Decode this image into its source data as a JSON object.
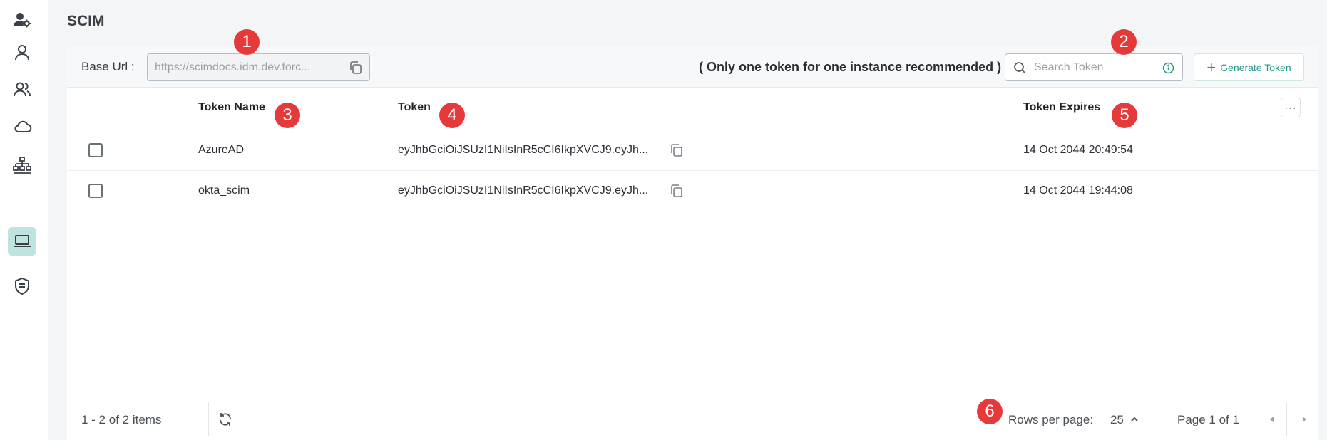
{
  "sidebar": {
    "items": [
      {
        "icon": "user-gear-icon",
        "active": false
      },
      {
        "icon": "user-icon",
        "active": false
      },
      {
        "icon": "users-icon",
        "active": false
      },
      {
        "icon": "cloud-icon",
        "active": false
      },
      {
        "icon": "hierarchy-icon",
        "active": false
      },
      {
        "icon": "laptop-icon",
        "active": true
      },
      {
        "icon": "shield-icon",
        "active": false
      }
    ]
  },
  "page": {
    "title": "SCIM"
  },
  "toolbar": {
    "base_url_label": "Base Url :",
    "base_url_value": "https://scimdocs.idm.dev.forc...",
    "note": "( Only one token for one instance recommended )",
    "search_placeholder": "Search Token",
    "generate_label": "Generate Token"
  },
  "table": {
    "columns": [
      "Token Name",
      "Token",
      "Token Expires"
    ],
    "rows": [
      {
        "name": "AzureAD",
        "token": "eyJhbGciOiJSUzI1NiIsInR5cCI6IkpXVCJ9.eyJh...",
        "expires": "14 Oct 2044 20:49:54"
      },
      {
        "name": "okta_scim",
        "token": "eyJhbGciOiJSUzI1NiIsInR5cCI6IkpXVCJ9.eyJh...",
        "expires": "14 Oct 2044 19:44:08"
      }
    ],
    "more_label": "···"
  },
  "footer": {
    "count": "1 - 2 of 2 items",
    "rows_per_page_label": "Rows per page:",
    "rows_per_page_value": "25",
    "page_info": "Page 1 of 1"
  },
  "markers": [
    "1",
    "2",
    "3",
    "4",
    "5",
    "6"
  ],
  "colors": {
    "accent": "#1f9a8a",
    "active_nav": "#bfe3de",
    "marker": "#e63a3a"
  }
}
